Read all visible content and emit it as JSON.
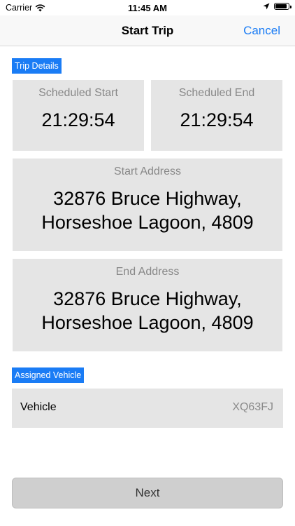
{
  "status_bar": {
    "carrier": "Carrier",
    "time": "11:45 AM"
  },
  "nav": {
    "title": "Start Trip",
    "cancel_label": "Cancel"
  },
  "trip_details": {
    "section_label": "Trip Details",
    "scheduled_start": {
      "label": "Scheduled Start",
      "value": "21:29:54"
    },
    "scheduled_end": {
      "label": "Scheduled End",
      "value": "21:29:54"
    },
    "start_address": {
      "label": "Start Address",
      "line1": "32876 Bruce Highway,",
      "line2": "Horseshoe Lagoon, 4809"
    },
    "end_address": {
      "label": "End Address",
      "line1": "32876 Bruce Highway,",
      "line2": "Horseshoe Lagoon, 4809"
    }
  },
  "assigned_vehicle": {
    "section_label": "Assigned Vehicle",
    "label": "Vehicle",
    "value": "XQ63FJ"
  },
  "footer": {
    "next_label": "Next"
  },
  "colors": {
    "accent": "#1a7cf5",
    "card_bg": "#e5e5e5",
    "button_bg": "#cfcfcf"
  }
}
